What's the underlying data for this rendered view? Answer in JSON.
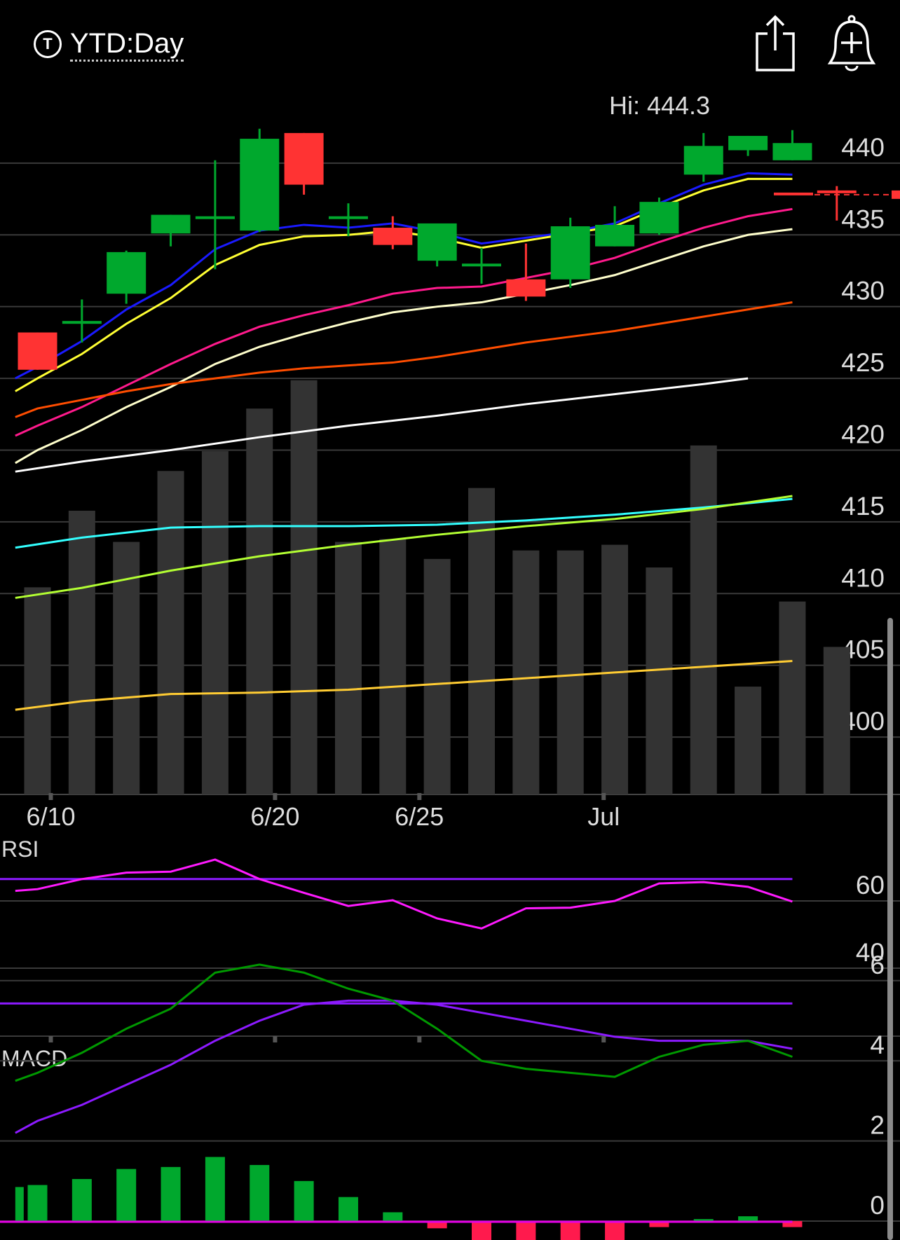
{
  "header": {
    "ticker_icon": "T",
    "period_label": "YTD:Day",
    "share_icon": "share-icon",
    "alert_icon": "add-alert-bell-icon"
  },
  "chart_data": [
    {
      "type": "candlestick",
      "title": "",
      "annotation": "Hi: 444.3",
      "ylim": [
        396,
        446
      ],
      "y_ticks": [
        440,
        435,
        430,
        425,
        420,
        415,
        410,
        405,
        400
      ],
      "x_tick_labels": [
        "6/10",
        "6/20",
        "6/25",
        "Jul"
      ],
      "colors": {
        "up": "#00a82d",
        "down": "#ff3333",
        "volume": "#333333"
      },
      "candles": [
        {
          "o": 428.2,
          "h": 428.2,
          "l": 425.6,
          "c": 425.6
        },
        {
          "o": 428.9,
          "h": 430.5,
          "l": 427.5,
          "c": 428.9
        },
        {
          "o": 430.9,
          "h": 433.9,
          "l": 430.2,
          "c": 433.8
        },
        {
          "o": 435.1,
          "h": 436.4,
          "l": 434.2,
          "c": 436.4
        },
        {
          "o": 436.2,
          "h": 440.2,
          "l": 432.6,
          "c": 436.2
        },
        {
          "o": 435.3,
          "h": 442.4,
          "l": 435.2,
          "c": 441.7
        },
        {
          "o": 442.1,
          "h": 442.1,
          "l": 437.8,
          "c": 438.5
        },
        {
          "o": 436.2,
          "h": 437.2,
          "l": 434.9,
          "c": 436.2
        },
        {
          "o": 435.5,
          "h": 436.3,
          "l": 434.0,
          "c": 434.3
        },
        {
          "o": 433.2,
          "h": 435.7,
          "l": 432.8,
          "c": 435.8
        },
        {
          "o": 432.9,
          "h": 434.1,
          "l": 431.6,
          "c": 432.9
        },
        {
          "o": 431.9,
          "h": 434.4,
          "l": 430.4,
          "c": 430.7
        },
        {
          "o": 431.9,
          "h": 436.2,
          "l": 431.3,
          "c": 435.6
        },
        {
          "o": 434.2,
          "h": 437.0,
          "l": 434.2,
          "c": 435.7
        },
        {
          "o": 435.1,
          "h": 437.6,
          "l": 435.0,
          "c": 437.3
        },
        {
          "o": 439.2,
          "h": 442.1,
          "l": 438.7,
          "c": 441.2
        },
        {
          "o": 440.9,
          "h": 441.9,
          "l": 440.5,
          "c": 441.9
        },
        {
          "o": 440.2,
          "h": 442.3,
          "l": 440.2,
          "c": 441.4
        },
        {
          "o": 438.0,
          "h": 438.4,
          "l": 436.0,
          "c": 437.9
        }
      ],
      "last_price_line": 437.9,
      "moving_averages": [
        {
          "color": "#1a1aff",
          "points": [
            [
              -0.5,
              425.0
            ],
            [
              0,
              425.8
            ],
            [
              1,
              427.6
            ],
            [
              2,
              429.8
            ],
            [
              3,
              431.5
            ],
            [
              4,
              434.0
            ],
            [
              5,
              435.3
            ],
            [
              6,
              435.7
            ],
            [
              7,
              435.5
            ],
            [
              8,
              435.8
            ],
            [
              9,
              435.2
            ],
            [
              10,
              434.4
            ],
            [
              11,
              434.8
            ],
            [
              12,
              435.2
            ],
            [
              13,
              435.8
            ],
            [
              14,
              437.2
            ],
            [
              15,
              438.5
            ],
            [
              16,
              439.3
            ],
            [
              17,
              439.2
            ]
          ]
        },
        {
          "color": "#ffff33",
          "points": [
            [
              -0.5,
              424.1
            ],
            [
              0,
              425.0
            ],
            [
              1,
              426.7
            ],
            [
              2,
              428.8
            ],
            [
              3,
              430.6
            ],
            [
              4,
              432.9
            ],
            [
              5,
              434.3
            ],
            [
              6,
              434.9
            ],
            [
              7,
              435.0
            ],
            [
              8,
              435.3
            ],
            [
              9,
              434.8
            ],
            [
              10,
              434.1
            ],
            [
              11,
              434.6
            ],
            [
              12,
              435.1
            ],
            [
              13,
              435.6
            ],
            [
              14,
              436.9
            ],
            [
              15,
              438.1
            ],
            [
              16,
              438.9
            ],
            [
              17,
              438.9
            ]
          ]
        },
        {
          "color": "#ff1a8c",
          "points": [
            [
              -0.5,
              421.0
            ],
            [
              0,
              421.7
            ],
            [
              1,
              423.0
            ],
            [
              2,
              424.5
            ],
            [
              3,
              426.0
            ],
            [
              4,
              427.4
            ],
            [
              5,
              428.6
            ],
            [
              6,
              429.4
            ],
            [
              7,
              430.1
            ],
            [
              8,
              430.9
            ],
            [
              9,
              431.3
            ],
            [
              10,
              431.4
            ],
            [
              11,
              432.0
            ],
            [
              12,
              432.6
            ],
            [
              13,
              433.4
            ],
            [
              14,
              434.5
            ],
            [
              15,
              435.5
            ],
            [
              16,
              436.3
            ],
            [
              17,
              436.8
            ]
          ]
        },
        {
          "color": "#ffffcc",
          "points": [
            [
              -0.5,
              419.1
            ],
            [
              0,
              420.0
            ],
            [
              1,
              421.4
            ],
            [
              2,
              423.0
            ],
            [
              3,
              424.4
            ],
            [
              4,
              426.0
            ],
            [
              5,
              427.2
            ],
            [
              6,
              428.1
            ],
            [
              7,
              428.9
            ],
            [
              8,
              429.6
            ],
            [
              9,
              430.0
            ],
            [
              10,
              430.3
            ],
            [
              11,
              430.9
            ],
            [
              12,
              431.5
            ],
            [
              13,
              432.2
            ],
            [
              14,
              433.2
            ],
            [
              15,
              434.2
            ],
            [
              16,
              435.0
            ],
            [
              17,
              435.4
            ]
          ]
        },
        {
          "color": "#ff4d00",
          "points": [
            [
              -0.5,
              422.3
            ],
            [
              0,
              422.9
            ],
            [
              1,
              423.5
            ],
            [
              2,
              424.1
            ],
            [
              3,
              424.6
            ],
            [
              4,
              425.0
            ],
            [
              5,
              425.4
            ],
            [
              6,
              425.7
            ],
            [
              7,
              425.9
            ],
            [
              8,
              426.1
            ],
            [
              9,
              426.5
            ],
            [
              10,
              427.0
            ],
            [
              11,
              427.5
            ],
            [
              12,
              427.9
            ],
            [
              13,
              428.3
            ],
            [
              14,
              428.8
            ],
            [
              15,
              429.3
            ],
            [
              16,
              429.8
            ],
            [
              17,
              430.3
            ]
          ]
        },
        {
          "color": "#ffffff",
          "points": [
            [
              -0.5,
              418.5
            ],
            [
              1,
              419.2
            ],
            [
              3,
              420.0
            ],
            [
              5,
              420.9
            ],
            [
              7,
              421.7
            ],
            [
              9,
              422.4
            ],
            [
              11,
              423.2
            ],
            [
              13,
              423.9
            ],
            [
              15,
              424.6
            ],
            [
              16,
              425.0
            ]
          ]
        },
        {
          "color": "#33ffff",
          "points": [
            [
              -0.5,
              413.2
            ],
            [
              1,
              413.9
            ],
            [
              3,
              414.6
            ],
            [
              5,
              414.7
            ],
            [
              7,
              414.7
            ],
            [
              9,
              414.8
            ],
            [
              11,
              415.1
            ],
            [
              13,
              415.5
            ],
            [
              15,
              416.0
            ],
            [
              17,
              416.6
            ]
          ]
        },
        {
          "color": "#b3ff33",
          "points": [
            [
              -0.5,
              409.7
            ],
            [
              1,
              410.4
            ],
            [
              3,
              411.6
            ],
            [
              5,
              412.6
            ],
            [
              7,
              413.4
            ],
            [
              9,
              414.1
            ],
            [
              11,
              414.7
            ],
            [
              13,
              415.2
            ],
            [
              15,
              415.9
            ],
            [
              17,
              416.8
            ]
          ]
        },
        {
          "color": "#ffcc33",
          "points": [
            [
              -0.5,
              401.9
            ],
            [
              1,
              402.5
            ],
            [
              3,
              403.0
            ],
            [
              5,
              403.1
            ],
            [
              7,
              403.3
            ],
            [
              9,
              403.7
            ],
            [
              11,
              404.1
            ],
            [
              13,
              404.5
            ],
            [
              15,
              404.9
            ],
            [
              17,
              405.3
            ]
          ]
        }
      ],
      "volume": [
        0.73,
        1.0,
        0.89,
        1.14,
        1.21,
        1.36,
        1.46,
        0.89,
        0.9,
        0.83,
        1.08,
        0.86,
        0.86,
        0.88,
        0.8,
        1.23,
        0.38,
        0.68,
        0.52
      ]
    },
    {
      "type": "line",
      "title": "RSI",
      "ylim": [
        20,
        80
      ],
      "y_ticks": [
        60,
        40
      ],
      "bands": [
        66.5,
        29.5
      ],
      "colors": {
        "line": "#ff1aff",
        "bands": "#8c1aff"
      },
      "x": [
        -0.5,
        0,
        1,
        2,
        3,
        4,
        5,
        6,
        7,
        8,
        9,
        10,
        11,
        12,
        13,
        14,
        15,
        16,
        17
      ],
      "values": [
        63.0,
        63.5,
        66.5,
        68.4,
        68.7,
        72.3,
        66.5,
        62.4,
        58.5,
        60.2,
        54.8,
        51.8,
        57.8,
        58.0,
        60.0,
        65.2,
        65.6,
        64.2,
        59.8
      ]
    },
    {
      "type": "line",
      "title": "MACD",
      "ylim": [
        -1.5,
        8
      ],
      "y_ticks": [
        6,
        4,
        2,
        0
      ],
      "colors": {
        "macd": "#009900",
        "signal": "#8c1aff",
        "hist_pos": "#00a82d",
        "hist_neg": "#ff1a4d",
        "zero": "#e600e6"
      },
      "x": [
        -0.5,
        0,
        1,
        2,
        3,
        4,
        5,
        6,
        7,
        8,
        9,
        10,
        11,
        12,
        13,
        14,
        15,
        16,
        17
      ],
      "macd": [
        3.5,
        3.7,
        4.2,
        4.8,
        5.3,
        6.2,
        6.4,
        6.2,
        5.8,
        5.5,
        4.8,
        4.0,
        3.8,
        3.7,
        3.6,
        4.1,
        4.4,
        4.5,
        4.1
      ],
      "signal": [
        2.2,
        2.5,
        2.9,
        3.4,
        3.9,
        4.5,
        5.0,
        5.4,
        5.5,
        5.5,
        5.4,
        5.2,
        5.0,
        4.8,
        4.6,
        4.5,
        4.5,
        4.5,
        4.3
      ],
      "histogram": [
        0.85,
        0.9,
        1.05,
        1.3,
        1.35,
        1.6,
        1.4,
        1.0,
        0.6,
        0.22,
        -0.18,
        -0.55,
        -0.6,
        -0.58,
        -0.48,
        -0.15,
        0.05,
        0.12,
        -0.15
      ]
    }
  ]
}
